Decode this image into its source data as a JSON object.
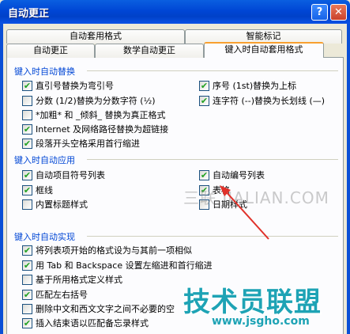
{
  "window": {
    "title": "自动更正"
  },
  "tabs": {
    "row1": [
      "自动套用格式",
      "智能标记"
    ],
    "row2": [
      "自动更正",
      "数学自动更正",
      "键入时自动套用格式"
    ]
  },
  "groups": {
    "replace": {
      "title": "键入时自动替换",
      "items": [
        {
          "label": "直引号替换为弯引号",
          "checked": true
        },
        {
          "label": "分数 (1/2)替换为分数字符 (½)",
          "checked": false
        },
        {
          "label": "*加粗* 和 _倾斜_ 替换为真正格式",
          "checked": false
        },
        {
          "label": "Internet 及网络路径替换为超链接",
          "checked": true
        },
        {
          "label": "段落开头空格采用首行缩进",
          "checked": true
        }
      ],
      "items_right": [
        {
          "label": "序号 (1st)替换为上标",
          "checked": true
        },
        {
          "label": "连字符 (--)替换为长划线 (—)",
          "checked": true
        }
      ]
    },
    "apply": {
      "title": "键入时自动应用",
      "items": [
        {
          "label": "自动项目符号列表",
          "checked": true
        },
        {
          "label": "框线",
          "checked": true
        },
        {
          "label": "内置标题样式",
          "checked": false
        }
      ],
      "items_right": [
        {
          "label": "自动编号列表",
          "checked": true
        },
        {
          "label": "表格",
          "checked": true
        },
        {
          "label": "日期样式",
          "checked": false
        }
      ]
    },
    "implement": {
      "title": "键入时自动实现",
      "items": [
        {
          "label": "将列表项开始的格式设为与其前一项相似",
          "checked": true
        },
        {
          "label": "用 Tab 和 Backspace 设置左缩进和首行缩进",
          "checked": true
        },
        {
          "label": "基于所用格式定义样式",
          "checked": false
        },
        {
          "label": "匹配左右括号",
          "checked": true
        },
        {
          "label": "删除中文和西文文字之间不必要的空",
          "checked": false
        },
        {
          "label": "插入结束语以匹配备忘录样式",
          "checked": true
        }
      ]
    }
  },
  "watermarks": {
    "a": "三联 JIALIAN.COM",
    "b": "技术员联盟",
    "c": "www.jsgho.com"
  },
  "colors": {
    "accent": "#0046d5",
    "check": "#21a121",
    "annotation_arrow": "#e0312a"
  }
}
